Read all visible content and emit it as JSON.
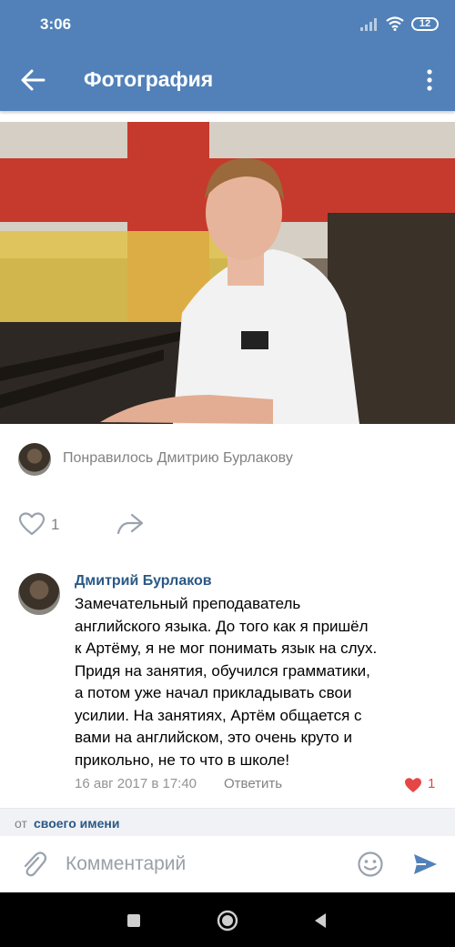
{
  "status_bar": {
    "time": "3:06",
    "battery": "12"
  },
  "app_bar": {
    "title": "Фотография"
  },
  "liked_by": {
    "text": "Понравилось Дмитрию Бурлакову"
  },
  "actions": {
    "like_count": "1"
  },
  "comment": {
    "author": "Дмитрий Бурлаков",
    "lines": [
      "Замечательный преподаватель",
      "английского языка. До того как я пришёл",
      "к Артёму, я не мог понимать язык на слух.",
      "Придя на занятия, обучился грамматики,",
      "а потом уже начал прикладывать свои",
      "усилии. На занятиях, Артём общается с",
      "вами на английском, это очень круто и",
      "прикольно, не то что в школе!"
    ],
    "date": "16 авг 2017 в 17:40",
    "reply_label": "Ответить",
    "like_count": "1"
  },
  "from_line": {
    "prefix": "от",
    "name": "своего имени"
  },
  "composer": {
    "placeholder": "Комментарий"
  },
  "colors": {
    "brand": "#5181b8",
    "link": "#2a5885",
    "like_red": "#e64646",
    "send_blue": "#5181b8"
  },
  "icons": {
    "back": "arrow-left-icon",
    "more": "more-vertical-icon",
    "like": "heart-outline-icon",
    "share": "share-arrow-icon",
    "attach": "paperclip-icon",
    "emoji": "smile-icon",
    "send": "send-icon"
  }
}
